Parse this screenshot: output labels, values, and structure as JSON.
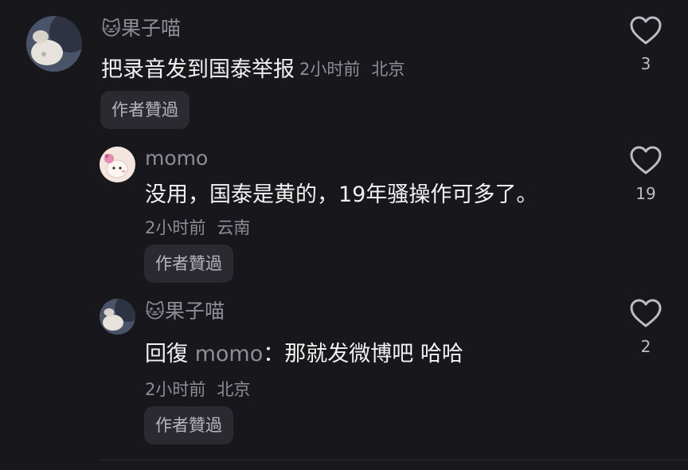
{
  "comments": [
    {
      "username_emoji": "🐱",
      "username": "果子喵",
      "text": "把录音发到国泰举报",
      "time": "2小时前",
      "location": "北京",
      "badge": "作者贊過",
      "likes": "3",
      "avatar": "cat-paw-avatar"
    },
    {
      "username": "momo",
      "text": "没用，国泰是黄的，19年骚操作可多了。",
      "time": "2小时前",
      "location": "云南",
      "badge": "作者贊過",
      "likes": "19",
      "avatar": "sticker-avatar"
    },
    {
      "username_emoji": "🐱",
      "username": "果子喵",
      "reply_prefix": "回復",
      "reply_target": "momo",
      "reply_colon": "：",
      "text": "那就发微博吧 哈哈",
      "time": "2小时前",
      "location": "北京",
      "badge": "作者贊過",
      "likes": "2",
      "avatar": "cat-paw-avatar"
    }
  ],
  "icons": {
    "like": "heart-outline-icon"
  },
  "colors": {
    "background": "#18171c",
    "secondary_text": "#8e8d93",
    "badge_bg": "#2b2a30"
  }
}
